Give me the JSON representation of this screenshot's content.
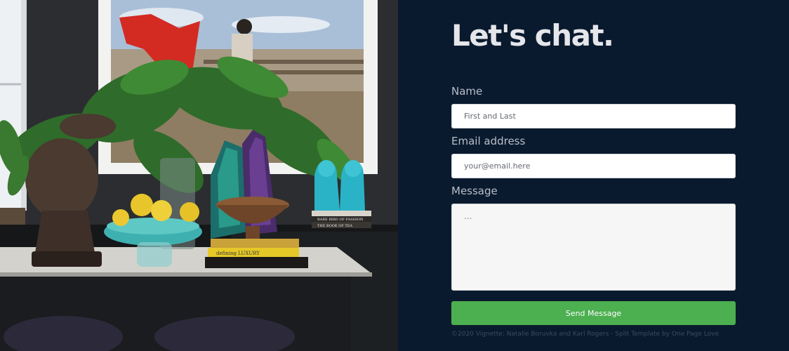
{
  "contact": {
    "heading": "Let's chat.",
    "name_label": "Name",
    "name_placeholder": "First and Last",
    "email_label": "Email address",
    "email_placeholder": "your@email.here",
    "message_label": "Message",
    "message_placeholder": "...",
    "submit_label": "Send Message"
  },
  "footer": {
    "credit": "©2020 Vignette: Natalie Boruvka and Karl Rogers - Split Template by One Page Love"
  },
  "photo": {
    "book_spines": [
      "RARE BIRD OF FASHION",
      "THE BOOK OF TEA",
      "defining LUXURY"
    ]
  },
  "colors": {
    "panel_background": "#0a1a2e",
    "button": "#4caf50",
    "heading": "#e4e6ea"
  }
}
